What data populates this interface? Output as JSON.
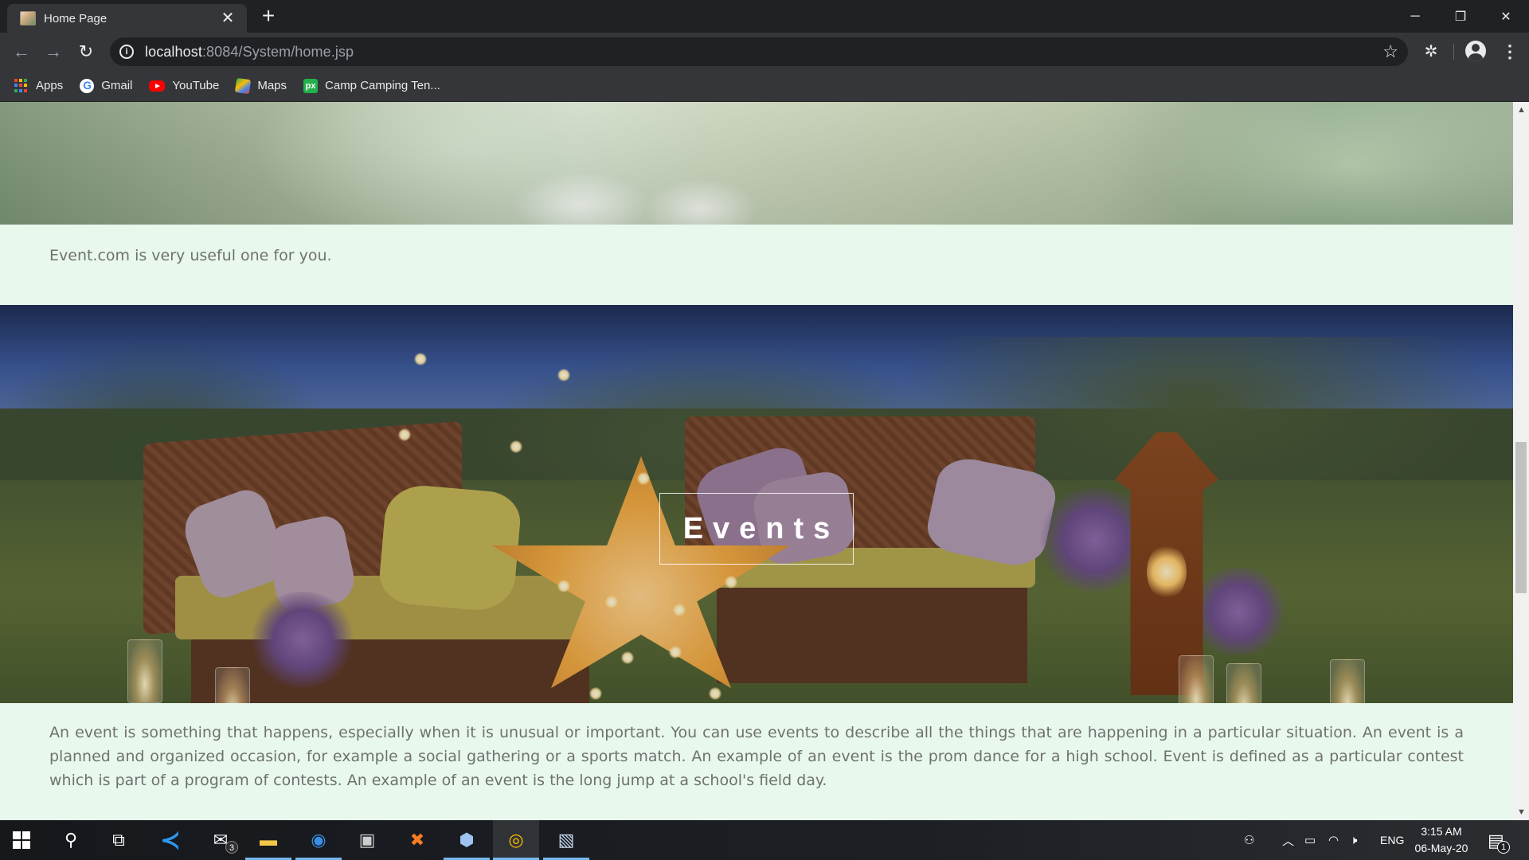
{
  "browser": {
    "tab": {
      "title": "Home Page",
      "close_glyph": "✕"
    },
    "new_tab_glyph": "+",
    "window_controls": {
      "minimize": "─",
      "maximize": "❐",
      "close": "✕"
    },
    "url": {
      "host": "localhost",
      "path": ":8084/System/home.jsp"
    },
    "nav": {
      "back": "←",
      "forward": "→",
      "reload": "↻"
    },
    "bookmarks": [
      {
        "label": "Apps",
        "icon": "apps-grid-icon"
      },
      {
        "label": "Gmail",
        "icon": "gmail-icon"
      },
      {
        "label": "YouTube",
        "icon": "youtube-icon"
      },
      {
        "label": "Maps",
        "icon": "maps-icon"
      },
      {
        "label": "Camp Camping Ten...",
        "icon": "px-icon"
      }
    ],
    "px_icon_text": "px"
  },
  "page": {
    "intro_text": "Event.com is very useful one for you.",
    "events_heading": "Events",
    "events_description": "An event is something that happens, especially when it is unusual or important. You can use events to describe all the things that are happening in a particular situation. An event is a planned and organized occasion, for example a social gathering or a sports match. An example of an event is the prom dance for a high school. Event is defined as a particular contest which is part of a program of contests. An example of an event is the long jump at a school's field day."
  },
  "taskbar": {
    "apps": [
      "search",
      "task-view",
      "vscode",
      "mail",
      "file-explorer",
      "firefox",
      "terminal",
      "xampp",
      "box-app",
      "chrome",
      "photos"
    ],
    "mail_badge": "3",
    "language": "ENG",
    "time": "3:15 AM",
    "date": "06-May-20",
    "notification_badge": "1"
  },
  "colors": {
    "page_bg": "#e8f8ec",
    "body_text": "#6f7170",
    "chrome_dark": "#202124",
    "chrome_toolbar": "#35363a"
  }
}
